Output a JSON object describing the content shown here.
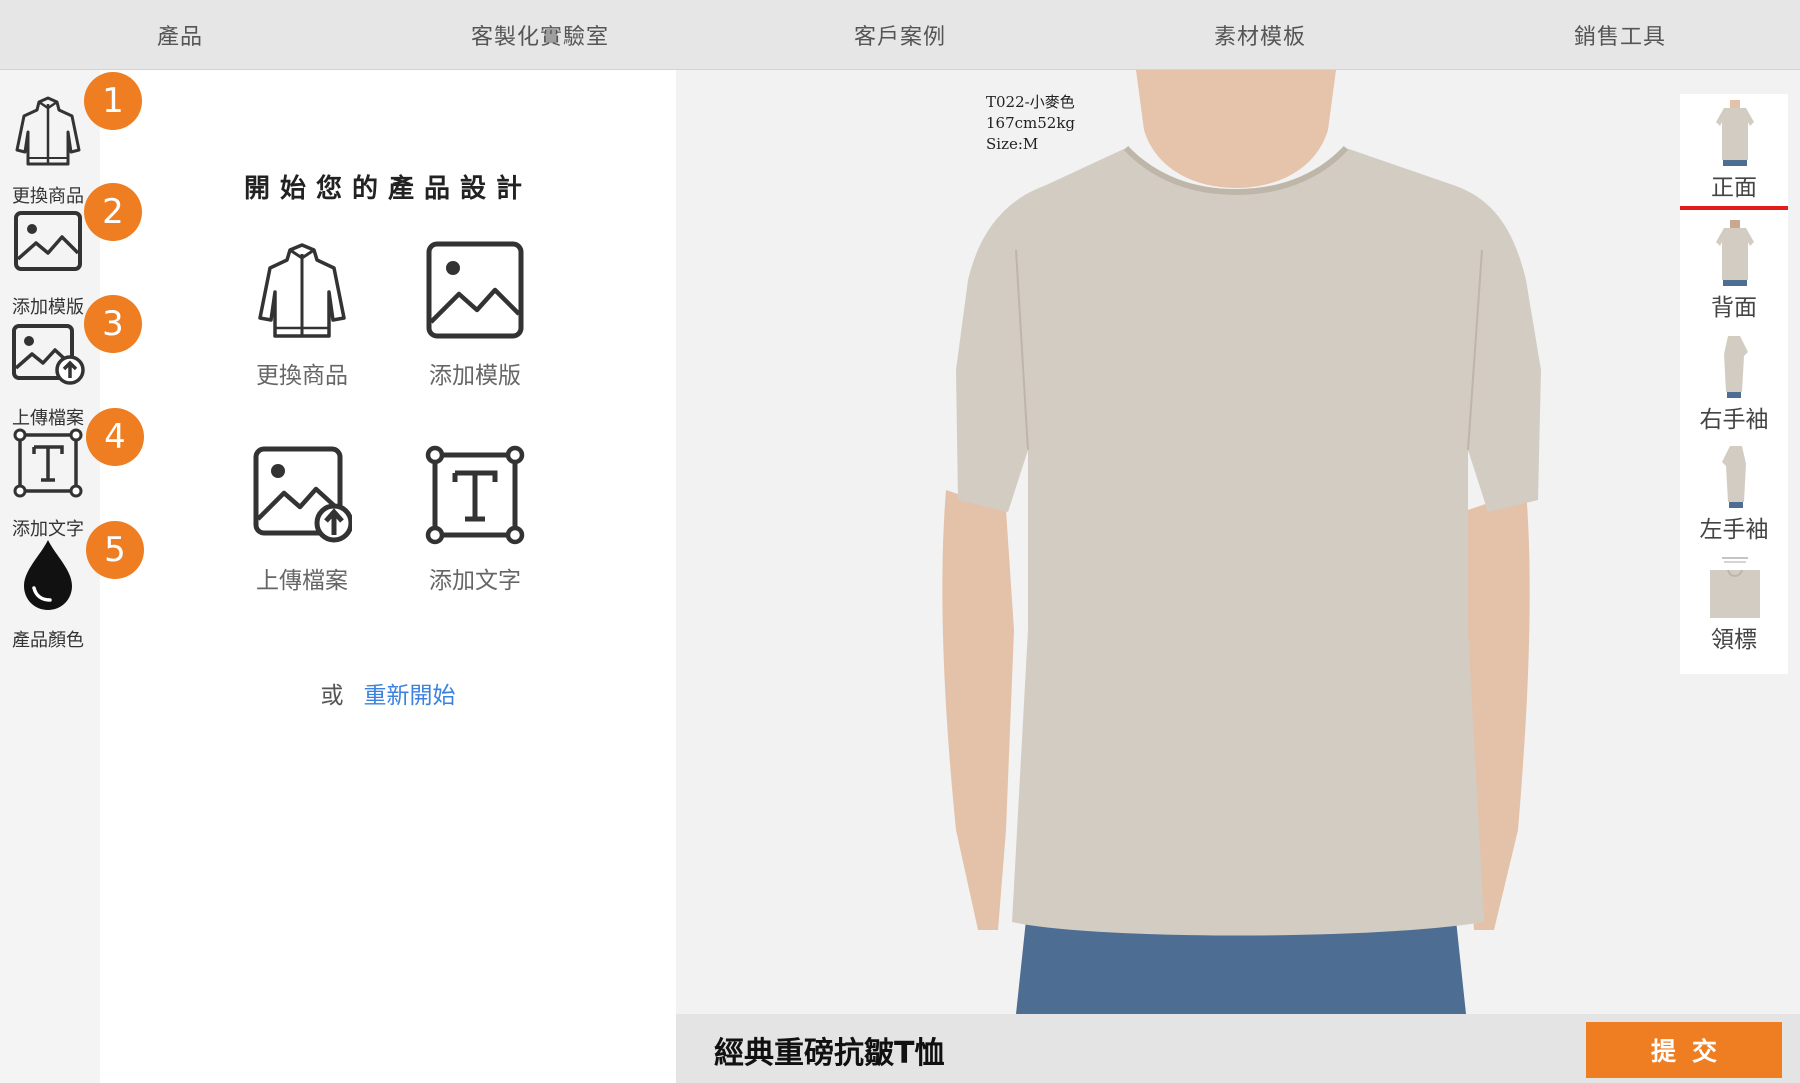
{
  "nav": {
    "items": [
      "產品",
      "客製化實驗室",
      "客戶案例",
      "素材模板",
      "銷售工具"
    ]
  },
  "toolbar": {
    "tools": [
      {
        "label": "更換商品",
        "icon": "jacket-icon",
        "badge": "1"
      },
      {
        "label": "添加模版",
        "icon": "image-icon",
        "badge": "2"
      },
      {
        "label": "上傳檔案",
        "icon": "image-upload-icon",
        "badge": "3"
      },
      {
        "label": "添加文字",
        "icon": "text-box-icon",
        "badge": "4"
      },
      {
        "label": "產品顏色",
        "icon": "color-drop-icon",
        "badge": "5"
      }
    ]
  },
  "panel": {
    "title": "開始您的產品設計",
    "options": [
      {
        "label": "更換商品",
        "icon": "jacket-icon"
      },
      {
        "label": "添加模版",
        "icon": "image-icon"
      },
      {
        "label": "上傳檔案",
        "icon": "image-upload-icon"
      },
      {
        "label": "添加文字",
        "icon": "text-box-icon"
      }
    ],
    "or_text": "或",
    "restart_link": "重新開始"
  },
  "preview": {
    "model_note": [
      "T022-小麥色",
      "167cm52kg",
      "Size:M"
    ],
    "shirt_color": "#d3ccc2"
  },
  "views": {
    "items": [
      "正面",
      "背面",
      "右手袖",
      "左手袖",
      "領標"
    ],
    "active": "正面"
  },
  "bottom": {
    "product_name": "經典重磅抗皺T恤",
    "submit_label": "提交"
  },
  "colors": {
    "accent": "#ef7d22",
    "link": "#3b82e0",
    "active_view": "#e21b1b"
  }
}
